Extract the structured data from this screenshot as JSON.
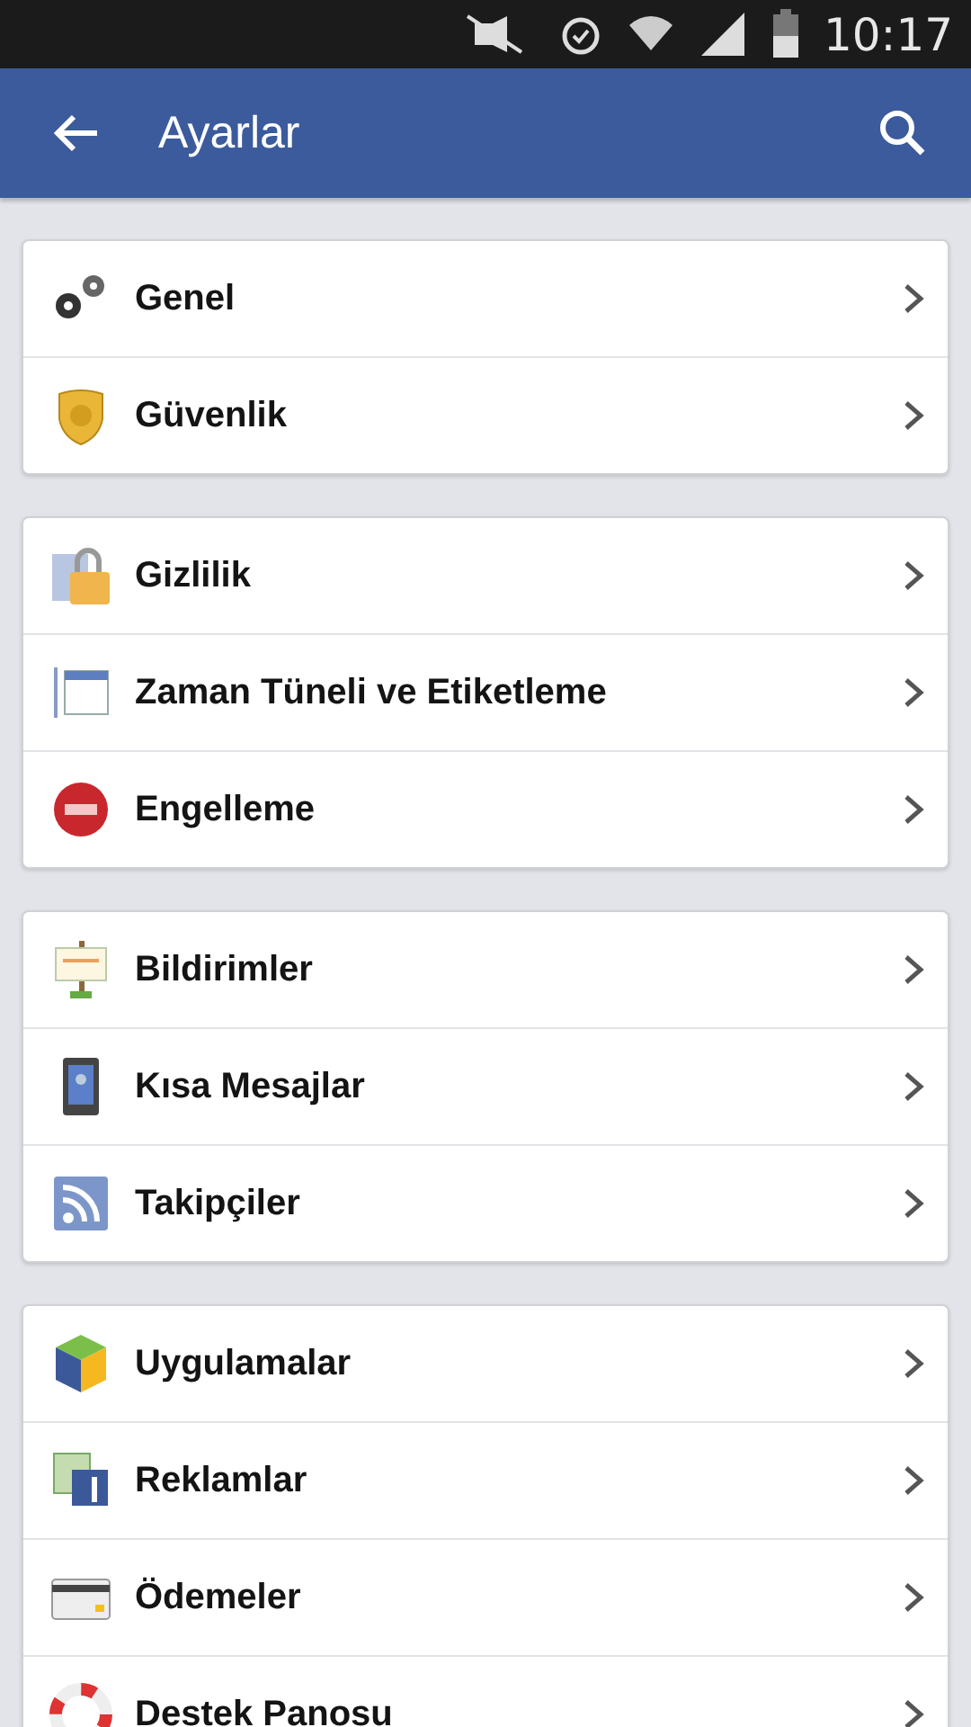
{
  "status_bar": {
    "time": "10:17"
  },
  "app_bar": {
    "title": "Ayarlar"
  },
  "groups": [
    {
      "items": [
        {
          "label": "Genel"
        },
        {
          "label": "Güvenlik"
        }
      ]
    },
    {
      "items": [
        {
          "label": "Gizlilik"
        },
        {
          "label": "Zaman Tüneli ve Etiketleme"
        },
        {
          "label": "Engelleme"
        }
      ]
    },
    {
      "items": [
        {
          "label": "Bildirimler"
        },
        {
          "label": "Kısa Mesajlar"
        },
        {
          "label": "Takipçiler"
        }
      ]
    },
    {
      "items": [
        {
          "label": "Uygulamalar"
        },
        {
          "label": "Reklamlar"
        },
        {
          "label": "Ödemeler"
        },
        {
          "label": "Destek Panosu"
        }
      ]
    }
  ]
}
